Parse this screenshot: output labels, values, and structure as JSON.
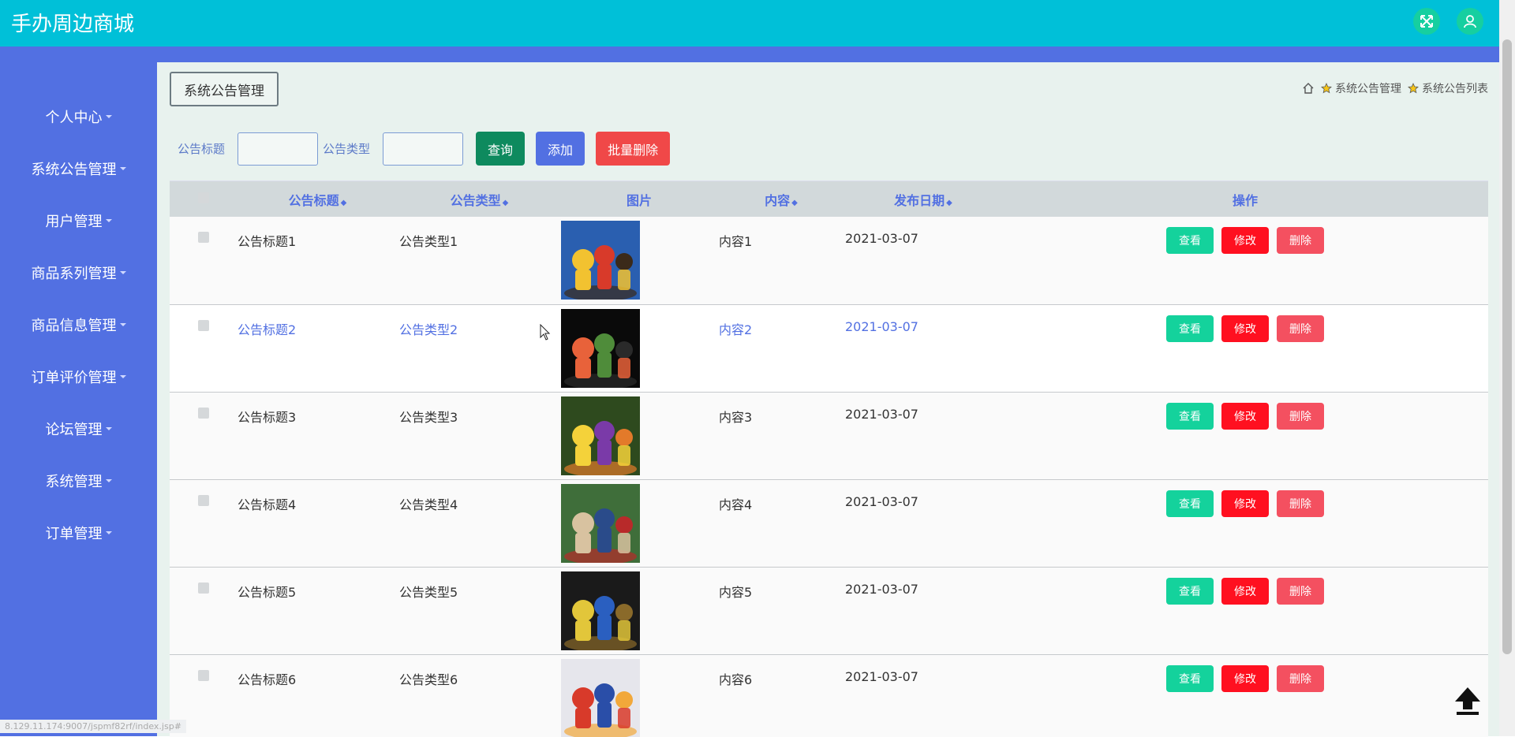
{
  "header": {
    "title": "手办周边商城"
  },
  "sidebar": {
    "items": [
      {
        "label": "个人中心"
      },
      {
        "label": "系统公告管理"
      },
      {
        "label": "用户管理"
      },
      {
        "label": "商品系列管理"
      },
      {
        "label": "商品信息管理"
      },
      {
        "label": "订单评价管理"
      },
      {
        "label": "论坛管理"
      },
      {
        "label": "系统管理"
      },
      {
        "label": "订单管理"
      }
    ]
  },
  "page": {
    "tag": "系统公告管理",
    "breadcrumb": [
      "系统公告管理",
      "系统公告列表"
    ]
  },
  "search": {
    "title_label": "公告标题",
    "title_value": "",
    "type_label": "公告类型",
    "type_value": "",
    "query_label": "查询",
    "add_label": "添加",
    "batch_delete_label": "批量删除"
  },
  "table": {
    "columns": [
      "公告标题",
      "公告类型",
      "图片",
      "内容",
      "发布日期",
      "操作"
    ],
    "actions": {
      "view": "查看",
      "edit": "修改",
      "delete": "删除"
    },
    "rows": [
      {
        "title": "公告标题1",
        "type": "公告类型1",
        "content": "内容1",
        "date": "2021-03-07",
        "image": "figure-1"
      },
      {
        "title": "公告标题2",
        "type": "公告类型2",
        "content": "内容2",
        "date": "2021-03-07",
        "image": "figure-2"
      },
      {
        "title": "公告标题3",
        "type": "公告类型3",
        "content": "内容3",
        "date": "2021-03-07",
        "image": "figure-3"
      },
      {
        "title": "公告标题4",
        "type": "公告类型4",
        "content": "内容4",
        "date": "2021-03-07",
        "image": "figure-4"
      },
      {
        "title": "公告标题5",
        "type": "公告类型5",
        "content": "内容5",
        "date": "2021-03-07",
        "image": "figure-5"
      },
      {
        "title": "公告标题6",
        "type": "公告类型6",
        "content": "内容6",
        "date": "2021-03-07",
        "image": "figure-6"
      }
    ]
  },
  "status_url": "8.129.11.174:9007/jspmf82rf/index.jsp#",
  "colors": {
    "topbar": "#00c0d8",
    "sidebar": "#5270e2",
    "view": "#14d29c",
    "edit": "#ff1020",
    "delete": "#f45060"
  }
}
